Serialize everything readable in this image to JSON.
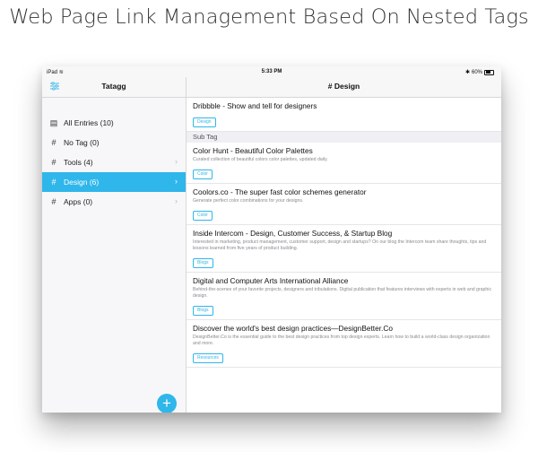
{
  "headline": "Web Page Link Management Based On Nested Tags",
  "status_bar": {
    "device": "iPad",
    "time": "5:33 PM",
    "battery": "60%"
  },
  "sidebar": {
    "title": "Tatagg",
    "items": [
      {
        "label": "All Entries (10)",
        "icon": "list-icon",
        "glyph": "▤",
        "active": false,
        "chevron": false
      },
      {
        "label": "No Tag (0)",
        "icon": "hashtag-icon",
        "glyph": "#",
        "active": false,
        "chevron": false
      },
      {
        "label": "Tools (4)",
        "icon": "hashtag-icon",
        "glyph": "#",
        "active": false,
        "chevron": true
      },
      {
        "label": "Design (6)",
        "icon": "hashtag-icon",
        "glyph": "#",
        "active": true,
        "chevron": true
      },
      {
        "label": "Apps (0)",
        "icon": "hashtag-icon",
        "glyph": "#",
        "active": false,
        "chevron": true
      }
    ],
    "add_button": "+"
  },
  "main": {
    "title": "# Design",
    "top_entry": {
      "title": "Dribbble - Show and tell for designers",
      "tag": "Design"
    },
    "section_header": "Sub Tag",
    "entries": [
      {
        "title": "Color Hunt - Beautiful Color Palettes",
        "desc": "Curated collection of beautiful colors color palettes, updated daily.",
        "tag": "Color"
      },
      {
        "title": "Coolors.co - The super fast color schemes generator",
        "desc": "Generate perfect color combinations for your designs.",
        "tag": "Color"
      },
      {
        "title": "Inside Intercom - Design, Customer Success, & Startup Blog",
        "desc": "Interested in marketing, product management, customer support, design and startups? On our blog the Intercom team share thoughts, tips and lessons learned from five years of product building.",
        "tag": "Blogs"
      },
      {
        "title": "Digital and Computer Arts International Alliance",
        "desc": "Behind-the-scenes of your favorite projects, designers and tribulations. Digital publication that features interviews with experts in web and graphic design.",
        "tag": "Blogs"
      },
      {
        "title": "Discover the world's best design practices—DesignBetter.Co",
        "desc": "DesignBetter.Co is the essential guide to the best design practices from top design experts. Learn how to build a world-class design organization and more.",
        "tag": "Resources"
      }
    ]
  },
  "colors": {
    "accent": "#2fb6ea",
    "sidebar_bg": "#f7f7f9",
    "section_bg": "#efeff4"
  }
}
